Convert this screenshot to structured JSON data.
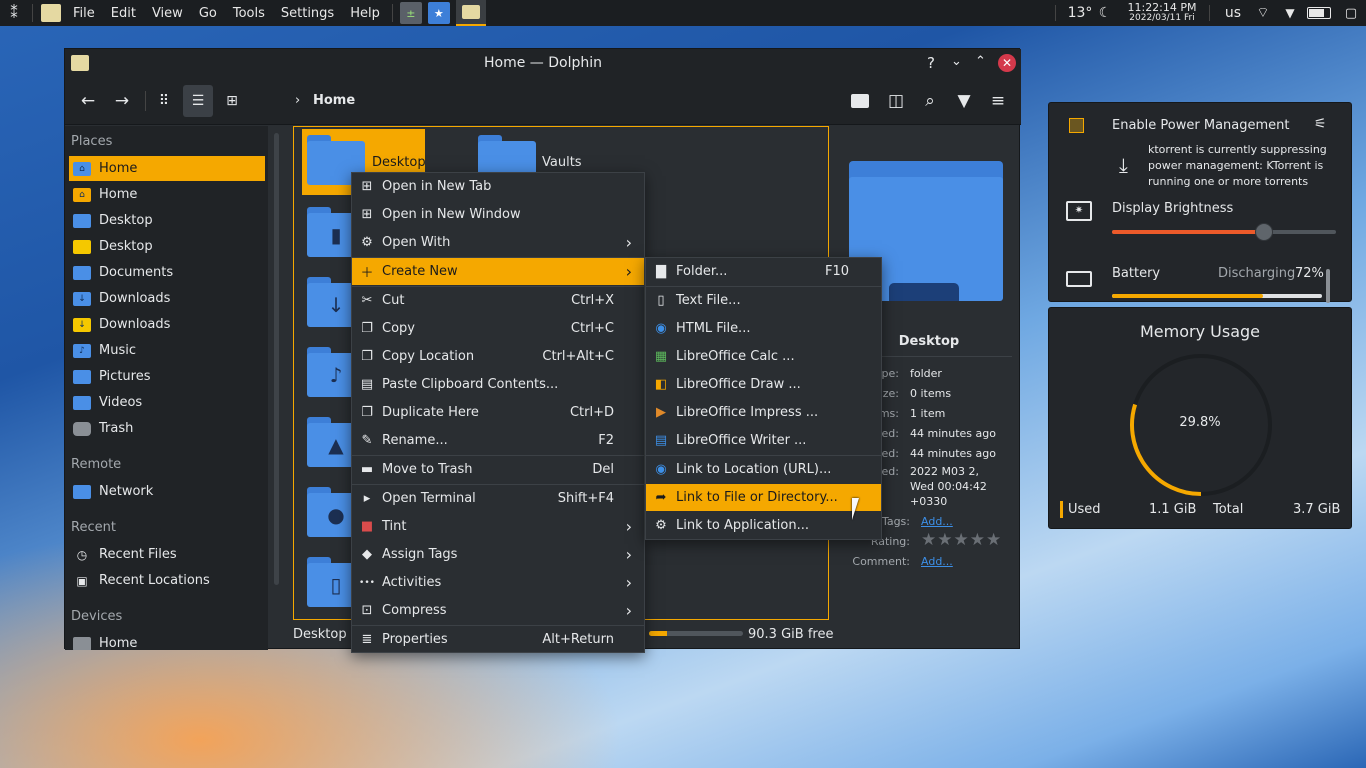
{
  "panel": {
    "menus": [
      "File",
      "Edit",
      "View",
      "Go",
      "Tools",
      "Settings",
      "Help"
    ],
    "temperature": "13°",
    "time": "11:22:14 PM",
    "date": "2022/03/11 Fri",
    "keyboard_layout": "us"
  },
  "window": {
    "title": "Home — Dolphin",
    "breadcrumb": "Home"
  },
  "sidebar": {
    "places_label": "Places",
    "places": [
      "Home",
      "Home",
      "Desktop",
      "Desktop",
      "Documents",
      "Downloads",
      "Downloads",
      "Music",
      "Pictures",
      "Videos",
      "Trash"
    ],
    "remote_label": "Remote",
    "remote": [
      "Network"
    ],
    "recent_label": "Recent",
    "recent": [
      "Recent Files",
      "Recent Locations"
    ],
    "devices_label": "Devices",
    "devices": [
      "Home"
    ]
  },
  "files": {
    "items": [
      "Desktop",
      "Vaults"
    ]
  },
  "status": {
    "left": "Desktop (",
    "free": "90.3 GiB free"
  },
  "info": {
    "name": "Desktop",
    "rows": [
      {
        "label": "Type:",
        "value": "folder"
      },
      {
        "label": "Size:",
        "value": "0 items"
      },
      {
        "label": "tems:",
        "value": "1 item"
      },
      {
        "label": "ified:",
        "value": "44 minutes ago"
      },
      {
        "label": "essed:",
        "value": "44 minutes ago"
      },
      {
        "label": "eated:",
        "value": "2022 M03 2,"
      },
      {
        "label": "",
        "value": "Wed 00:04:42"
      },
      {
        "label": "",
        "value": "+0330"
      }
    ],
    "tags_label": "Tags:",
    "tags_value": "Add...",
    "rating_label": "Rating:",
    "comment_label": "Comment:",
    "comment_value": "Add..."
  },
  "context_menu": {
    "items": [
      {
        "label": "Open in New Tab",
        "shortcut": "",
        "icon": "new-tab-icon"
      },
      {
        "label": "Open in New Window",
        "shortcut": "",
        "icon": "new-window-icon"
      },
      {
        "label": "Open With",
        "shortcut": "",
        "icon": "gear-icon"
      },
      {
        "label": "Create New",
        "shortcut": "",
        "icon": "plus-icon"
      },
      {
        "label": "Cut",
        "shortcut": "Ctrl+X",
        "icon": "scissors-icon"
      },
      {
        "label": "Copy",
        "shortcut": "Ctrl+C",
        "icon": "copy-icon"
      },
      {
        "label": "Copy Location",
        "shortcut": "Ctrl+Alt+C",
        "icon": "copy-icon"
      },
      {
        "label": "Paste Clipboard Contents...",
        "shortcut": "",
        "icon": "paste-icon"
      },
      {
        "label": "Duplicate Here",
        "shortcut": "Ctrl+D",
        "icon": "duplicate-icon"
      },
      {
        "label": "Rename...",
        "shortcut": "F2",
        "icon": "pencil-icon"
      },
      {
        "label": "Move to Trash",
        "shortcut": "Del",
        "icon": "trash-icon"
      },
      {
        "label": "Open Terminal",
        "shortcut": "Shift+F4",
        "icon": "terminal-icon"
      },
      {
        "label": "Tint",
        "shortcut": "",
        "icon": "folder-red-icon"
      },
      {
        "label": "Assign Tags",
        "shortcut": "",
        "icon": "tag-icon"
      },
      {
        "label": "Activities",
        "shortcut": "",
        "icon": "dots-icon"
      },
      {
        "label": "Compress",
        "shortcut": "",
        "icon": "archive-icon"
      },
      {
        "label": "Properties",
        "shortcut": "Alt+Return",
        "icon": "list-icon"
      }
    ]
  },
  "submenu": {
    "items": [
      {
        "label": "Folder...",
        "shortcut": "F10",
        "icon": "folder-icon"
      },
      {
        "label": "Text File...",
        "shortcut": "",
        "icon": "text-file-icon"
      },
      {
        "label": "HTML File...",
        "shortcut": "",
        "icon": "html-file-icon"
      },
      {
        "label": "LibreOffice Calc  ...",
        "shortcut": "",
        "icon": "calc-icon"
      },
      {
        "label": "LibreOffice Draw  ...",
        "shortcut": "",
        "icon": "draw-icon"
      },
      {
        "label": "LibreOffice Impress  ...",
        "shortcut": "",
        "icon": "impress-icon"
      },
      {
        "label": "LibreOffice Writer  ...",
        "shortcut": "",
        "icon": "writer-icon"
      },
      {
        "label": "Link to Location (URL)...",
        "shortcut": "",
        "icon": "link-url-icon"
      },
      {
        "label": "Link to File or Directory...",
        "shortcut": "",
        "icon": "link-file-icon"
      },
      {
        "label": "Link to Application...",
        "shortcut": "",
        "icon": "gear-icon"
      }
    ]
  },
  "power_popup": {
    "power_title": "Enable Power Management",
    "inhibit_text_1": "ktorrent is currently suppressing",
    "inhibit_text_2": "power management: KTorrent is",
    "inhibit_text_3": "running one or more torrents",
    "brightness_label": "Display Brightness",
    "brightness_level": 0.68,
    "battery_label": "Battery",
    "battery_status": "Discharging",
    "battery_percent": "72%",
    "battery_level": 0.72
  },
  "memory": {
    "title": "Memory Usage",
    "percent": "29.8%",
    "percent_value": 29.8,
    "used_label": "Used",
    "used_value": "1.1 GiB",
    "total_label": "Total",
    "total_value": "3.7 GiB"
  },
  "colors": {
    "accent": "#f5a800",
    "folder": "#4a8fe6"
  }
}
